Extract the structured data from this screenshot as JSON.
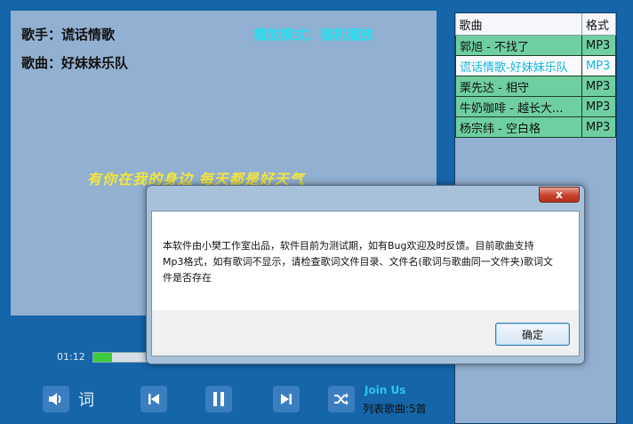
{
  "lyrics_panel": {
    "singer_label": "歌手：谎话情歌",
    "song_label": "歌曲：好妹妹乐队",
    "play_mode": "播放模式：随机播放",
    "current_lyric": "有你在我的身边  每天都是好天气"
  },
  "playlist": {
    "headers": [
      "歌曲",
      "格式"
    ],
    "rows": [
      {
        "song": "郭旭 - 不找了",
        "format": "MP3"
      },
      {
        "song": "谎话情歌-好妹妹乐队",
        "format": "MP3"
      },
      {
        "song": "栗先达 - 相守",
        "format": "MP3"
      },
      {
        "song": "牛奶咖啡 - 越长大...",
        "format": "MP3"
      },
      {
        "song": "杨宗纬 - 空白格",
        "format": "MP3"
      }
    ],
    "active_index": 1
  },
  "player": {
    "current_time": "01:12",
    "progress": 0.3,
    "lyrics_toggle_label": "词",
    "join_us": "Join Us",
    "list_count": "列表歌曲:5首"
  },
  "dialog": {
    "close_label": "x",
    "message": "本软件由小樊工作室出品，软件目前为测试期，如有Bug欢迎及时反馈。目前歌曲支持Mp3格式，如有歌词不显示，请检查歌词文件目录、文件名(歌词与歌曲同一文件夹)歌词文件是否存在",
    "ok_label": "确定"
  },
  "colors": {
    "background": "#1565a8",
    "panel": "#92b0d1",
    "lyric": "#f4e73a",
    "play_mode": "#22e0f0",
    "row": "#6fcfa1"
  }
}
